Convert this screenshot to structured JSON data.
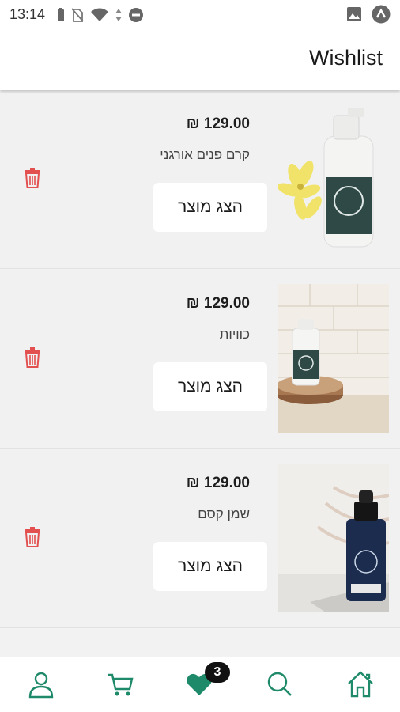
{
  "status_bar": {
    "time": "13:14",
    "icons_left": [
      "battery-icon",
      "no-sim-icon",
      "wifi-icon",
      "do-not-disturb-icon"
    ],
    "icons_right": [
      "image-notification-icon",
      "app-notification-icon"
    ]
  },
  "header": {
    "title": "Wishlist"
  },
  "wishlist": {
    "items": [
      {
        "price": "129.00 ₪",
        "name": "קרם פנים אורגני",
        "button_label": "הצג מוצר",
        "image": "face-cream-bottle-with-lilies"
      },
      {
        "price": "129.00 ₪",
        "name": "כוויות",
        "button_label": "הצג מוצר",
        "image": "cream-bottle-on-wood-slice"
      },
      {
        "price": "129.00 ₪",
        "name": "שמן קסם",
        "button_label": "הצג מוצר",
        "image": "oil-dropper-bottle"
      }
    ]
  },
  "bottom_nav": {
    "items": [
      "profile-icon",
      "cart-icon",
      "heart-icon",
      "search-icon",
      "home-icon"
    ],
    "wishlist_badge": "3",
    "accent_color": "#1f8a6a"
  },
  "colors": {
    "trash": "#e35050",
    "accent": "#1f8a6a"
  }
}
